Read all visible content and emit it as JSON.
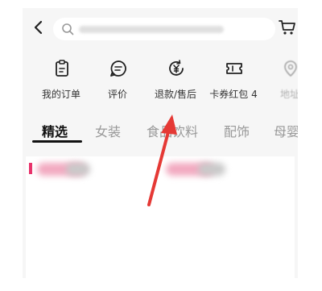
{
  "search": {
    "placeholder": "",
    "icon": "search-icon"
  },
  "header": {
    "back_icon": "back-chevron-icon",
    "cart_icon": "cart-icon"
  },
  "menu": {
    "items": [
      {
        "label": "我的订单",
        "icon": "order-list-icon"
      },
      {
        "label": "评价",
        "icon": "review-icon"
      },
      {
        "label": "退款/售后",
        "icon": "refund-yen-icon"
      },
      {
        "label": "卡券红包 4",
        "icon": "coupon-icon"
      },
      {
        "label": "地址",
        "icon": "location-icon"
      }
    ]
  },
  "tabs": {
    "items": [
      "精选",
      "女装",
      "食品饮料",
      "配饰",
      "母婴"
    ],
    "active_index": 0
  },
  "colors": {
    "accent": "#e8316a",
    "arrow": "#e53935",
    "background": "#f6f6f6"
  },
  "annotation": {
    "type": "arrow",
    "points_to": "menu-item-refund"
  }
}
